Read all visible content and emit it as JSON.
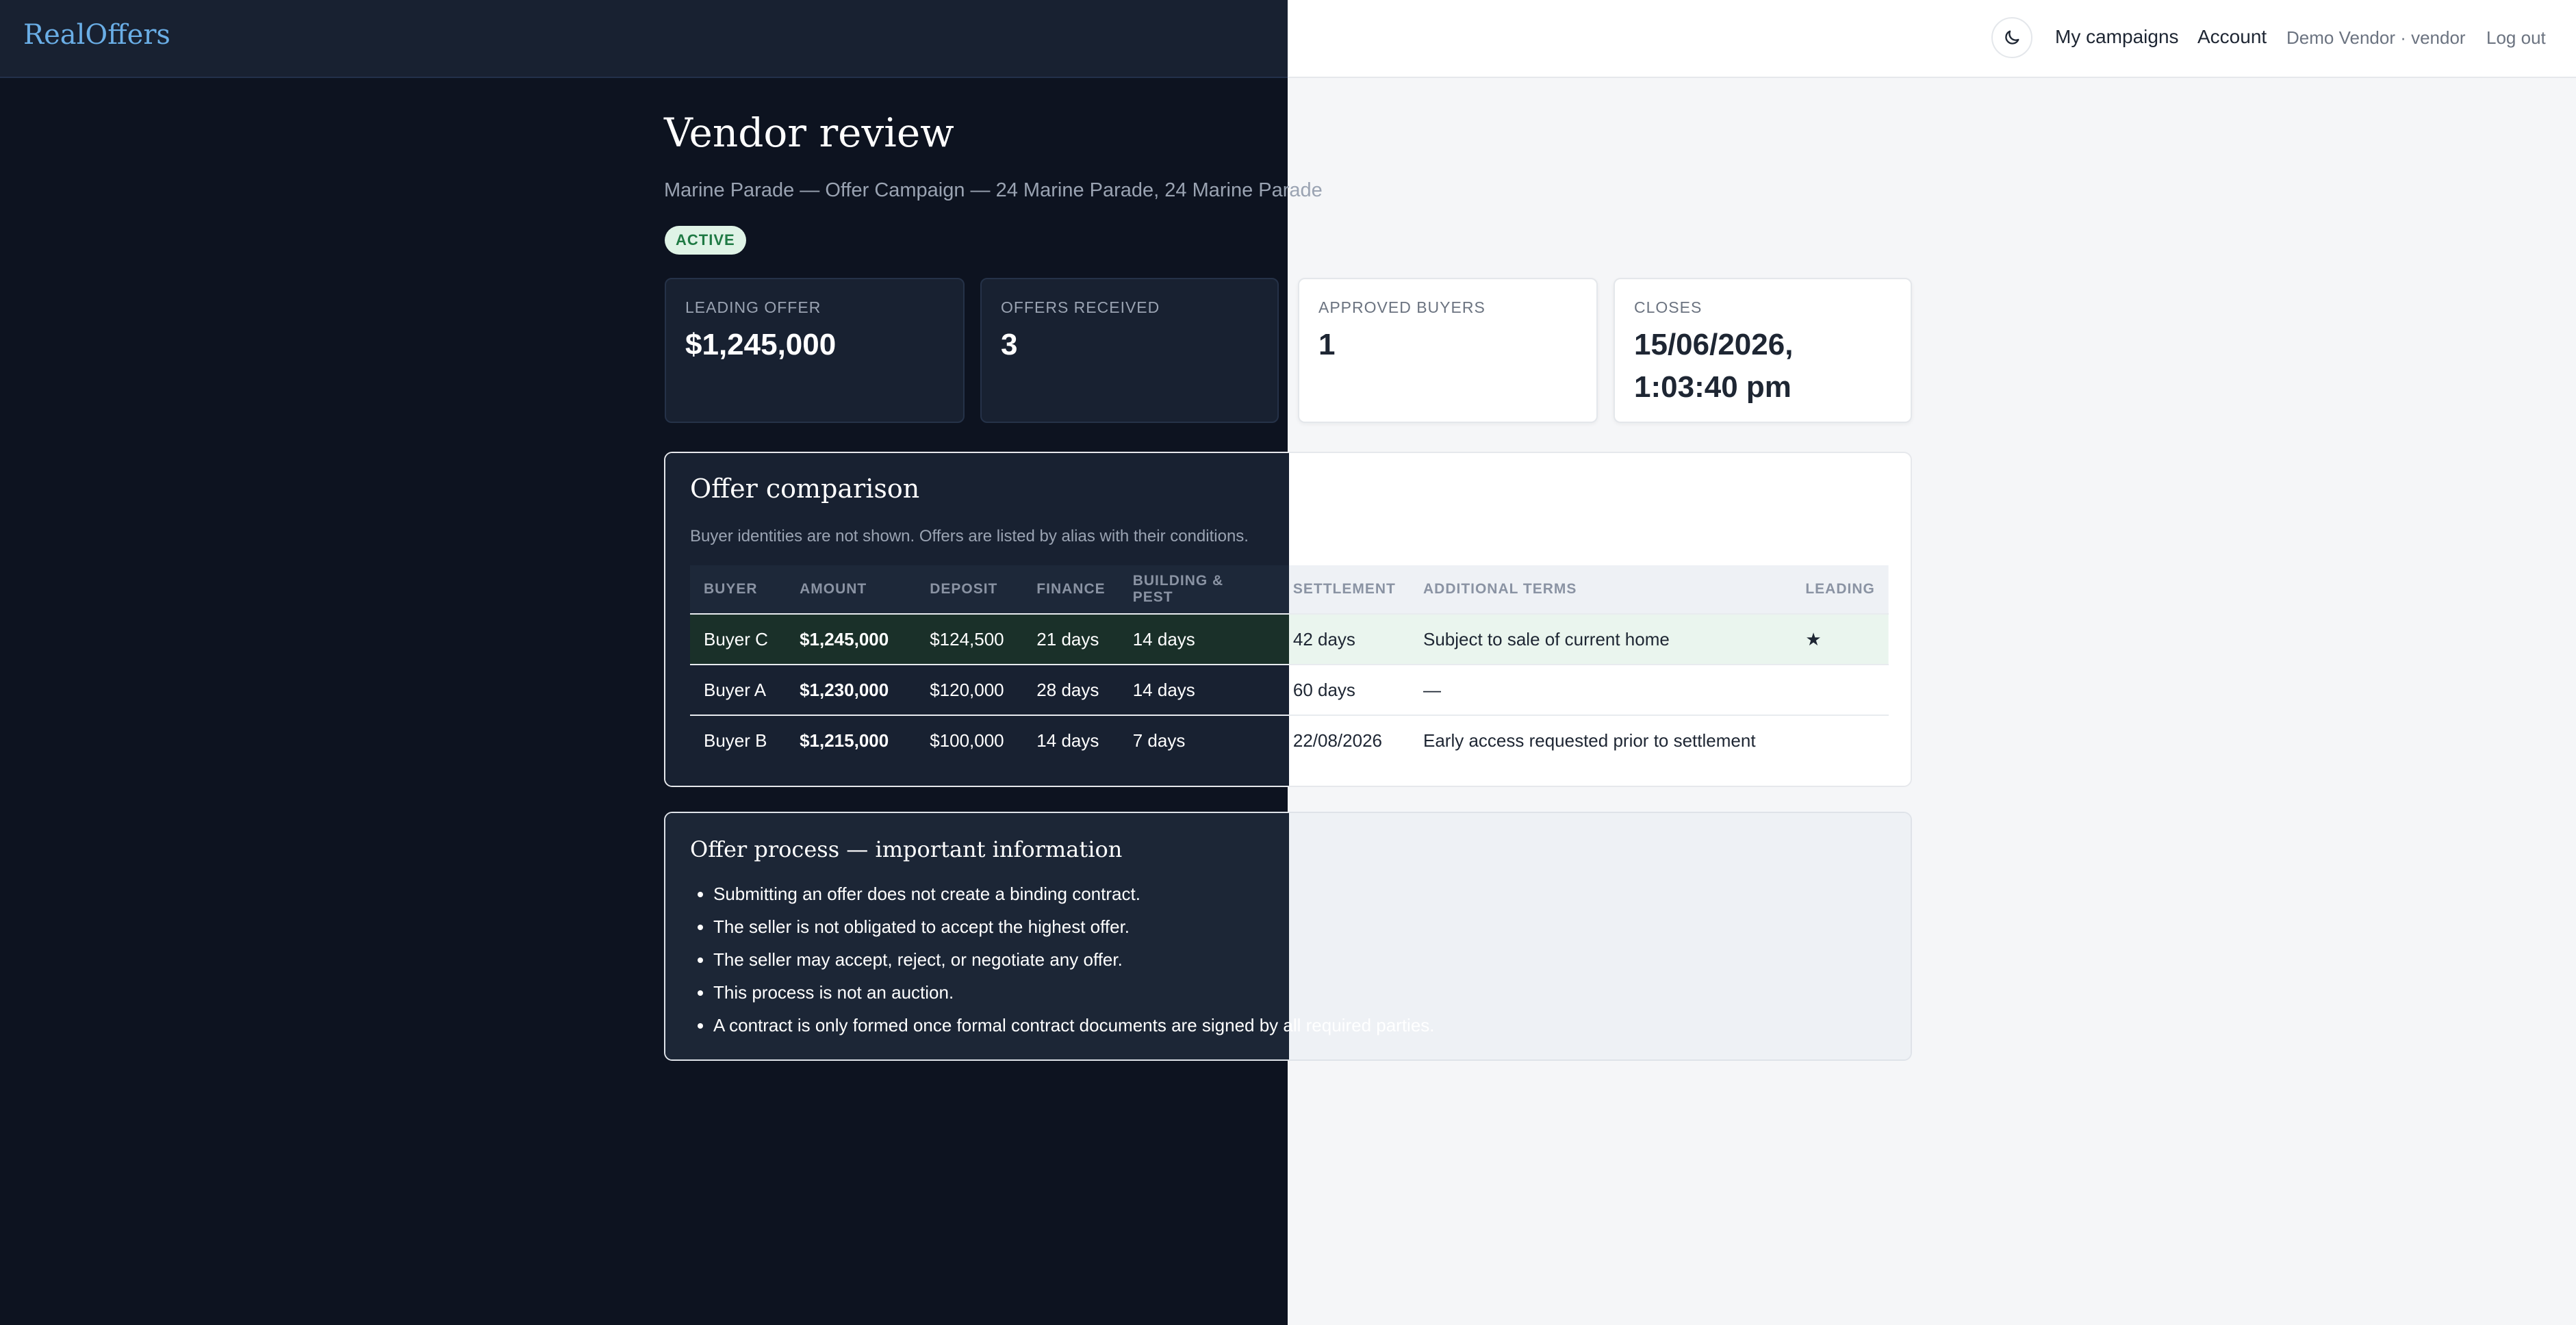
{
  "header": {
    "logo": "RealOffers",
    "nav": {
      "my_campaigns": "My campaigns",
      "account": "Account",
      "user": "Demo Vendor · vendor",
      "logout": "Log out"
    }
  },
  "page": {
    "title": "Vendor review",
    "subtitle": "Marine Parade — Offer Campaign — 24 Marine Parade, 24 Marine Parade",
    "status": "ACTIVE"
  },
  "stats": [
    {
      "label": "LEADING OFFER",
      "value": "$1,245,000"
    },
    {
      "label": "OFFERS RECEIVED",
      "value": "3"
    },
    {
      "label": "APPROVED BUYERS",
      "value": "1"
    },
    {
      "label": "CLOSES",
      "value_line1": "15/06/2026,",
      "value_line2": "1:03:40 pm"
    }
  ],
  "comparison": {
    "title": "Offer comparison",
    "note": "Buyer identities are not shown. Offers are listed by alias with their conditions.",
    "columns": [
      "BUYER",
      "AMOUNT",
      "DEPOSIT",
      "FINANCE",
      "BUILDING & PEST",
      "SETTLEMENT",
      "ADDITIONAL TERMS",
      "LEADING"
    ],
    "rows": [
      {
        "buyer": "Buyer C",
        "amount": "$1,245,000",
        "deposit": "$124,500",
        "finance": "21 days",
        "building_pest": "14 days",
        "settlement": "42 days",
        "terms": "Subject to sale of current home",
        "leading": "★"
      },
      {
        "buyer": "Buyer A",
        "amount": "$1,230,000",
        "deposit": "$120,000",
        "finance": "28 days",
        "building_pest": "14 days",
        "settlement": "60 days",
        "terms": "—",
        "leading": ""
      },
      {
        "buyer": "Buyer B",
        "amount": "$1,215,000",
        "deposit": "$100,000",
        "finance": "14 days",
        "building_pest": "7 days",
        "settlement": "22/08/2026",
        "terms": "Early access requested prior to settlement",
        "leading": ""
      }
    ]
  },
  "info": {
    "title": "Offer process — important information",
    "items": [
      "Submitting an offer does not create a binding contract.",
      "The seller is not obligated to accept the highest offer.",
      "The seller may accept, reject, or negotiate any offer.",
      "This process is not an auction.",
      "A contract is only formed once formal contract documents are signed by all required parties."
    ]
  },
  "icons": {
    "theme_toggle": "moon-icon",
    "leading_marker": "star-icon"
  },
  "colors": {
    "accent": "#6aaee6",
    "status_active_bg": "#dff3e6",
    "status_active_text": "#1f7a44",
    "leading_row_bg": "#eaf5ee"
  }
}
